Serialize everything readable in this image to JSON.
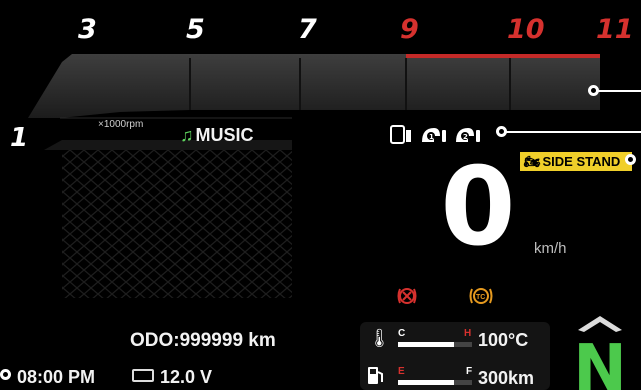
{
  "tachometer": {
    "marks": [
      "3",
      "5",
      "7",
      "9",
      "10",
      "11"
    ],
    "redline_from": "9",
    "first_mark": "1",
    "unit": "×1000rpm"
  },
  "media": {
    "label": "MUSIC",
    "icon": "music-note-icon"
  },
  "status_icons": [
    "phone-battery-icon",
    "rider-1-helmet-icon",
    "rider-2-helmet-icon"
  ],
  "side_stand": {
    "label": "SIDE STAND",
    "color": "#f0cf2a"
  },
  "speed": {
    "value": "0",
    "unit": "km/h"
  },
  "warnings": [
    {
      "icon": "abs-warning-icon",
      "color": "#d6312e"
    },
    {
      "icon": "traction-control-icon",
      "text": "TC",
      "color": "#e69a1f"
    }
  ],
  "odometer": {
    "text": "ODO:999999 km"
  },
  "clock": {
    "text": "08:00 PM"
  },
  "battery": {
    "text": "12.0 V"
  },
  "temperature": {
    "low": "C",
    "high": "H",
    "value": "100°C",
    "level": 0.75
  },
  "fuel": {
    "low": "E",
    "high": "F",
    "value": "300km",
    "level": 0.75
  },
  "gear": {
    "value": "N",
    "color": "#4cc94c"
  },
  "colors": {
    "redline": "#d6312e",
    "accent_green": "#4cc94c"
  }
}
